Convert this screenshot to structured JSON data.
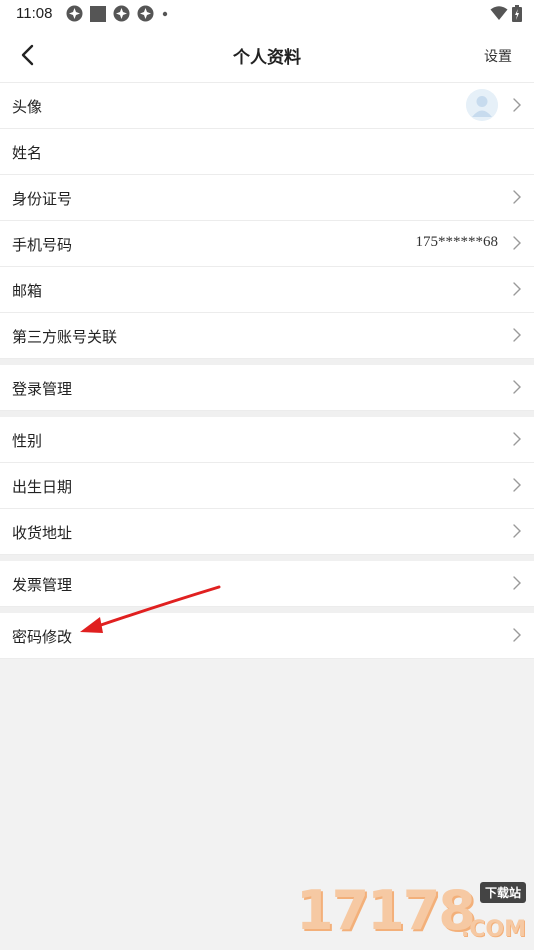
{
  "status_bar": {
    "time": "11:08",
    "icons_left": [
      "notification-app-icon",
      "notification-square-icon",
      "notification-app-icon",
      "notification-app-icon",
      "notification-dot-icon"
    ],
    "icons_right": [
      "wifi-icon",
      "battery-charging-icon"
    ]
  },
  "nav": {
    "back_icon": "chevron-left-icon",
    "title": "个人资料",
    "settings_label": "设置"
  },
  "groups": [
    {
      "rows": [
        {
          "label": "头像",
          "type": "avatar"
        },
        {
          "label": "姓名",
          "type": "plain"
        },
        {
          "label": "身份证号",
          "type": "chevron"
        },
        {
          "label": "手机号码",
          "type": "chevron",
          "value": "175******68"
        },
        {
          "label": "邮箱",
          "type": "chevron"
        },
        {
          "label": "第三方账号关联",
          "type": "chevron"
        }
      ]
    },
    {
      "rows": [
        {
          "label": "登录管理",
          "type": "chevron"
        }
      ]
    },
    {
      "rows": [
        {
          "label": "性别",
          "type": "chevron"
        },
        {
          "label": "出生日期",
          "type": "chevron"
        },
        {
          "label": "收货地址",
          "type": "chevron"
        }
      ]
    },
    {
      "rows": [
        {
          "label": "发票管理",
          "type": "chevron"
        }
      ]
    },
    {
      "rows": [
        {
          "label": "密码修改",
          "type": "chevron"
        }
      ]
    }
  ],
  "annotation": {
    "arrow_color": "#e02020"
  },
  "watermark": {
    "digits": "17178",
    "tag": "下载站",
    "suffix": ".COM"
  },
  "colors": {
    "background": "#f2f2f2",
    "row_background": "#ffffff",
    "divider": "#ececec",
    "chevron": "#9a9a9a",
    "avatar_bg": "#e6f0f8"
  }
}
